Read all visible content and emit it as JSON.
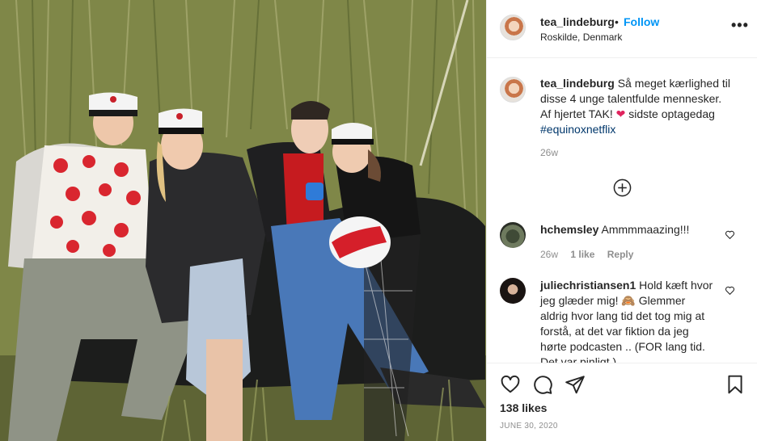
{
  "post": {
    "image_alt": "",
    "author": {
      "username": "tea_lindeburg",
      "separator": "•",
      "follow_label": "Follow",
      "location": "Roskilde, Denmark",
      "more_icon": "more-horizontal-icon"
    },
    "caption": {
      "username": "tea_lindeburg",
      "text_1": "Så meget kærlighed til",
      "text_2": "disse 4 unge talentfulde mennesker.",
      "text_3a": "Af hjertet TAK!",
      "emoji": "❤️",
      "text_3b": "sidste optagedag",
      "hashtag": "#equinoxnetflix",
      "age": "26w"
    },
    "load_more_icon": "plus-circle-icon",
    "comments": [
      {
        "username": "hchemsley",
        "text": "Ammmmaazing!!!",
        "age": "26w",
        "likes": "1 like",
        "reply": "Reply"
      },
      {
        "username": "juliechristiansen1",
        "text_1": "Hold kæft hvor",
        "text_2": "jeg glæder mig!",
        "emoji": "🙈",
        "text_2b": "Glemmer",
        "text_3": "aldrig hvor lang tid det tog mig at",
        "text_4": "forstå, at det var fiktion da jeg",
        "text_5": "hørte podcasten .. (FOR lang tid.",
        "text_6": "Det var pinligt.)"
      }
    ],
    "actions": {
      "like_icon": "heart-icon",
      "comment_icon": "comment-icon",
      "share_icon": "send-icon",
      "save_icon": "bookmark-icon"
    },
    "likes": "138 likes",
    "date": "JUNE 30, 2020"
  }
}
